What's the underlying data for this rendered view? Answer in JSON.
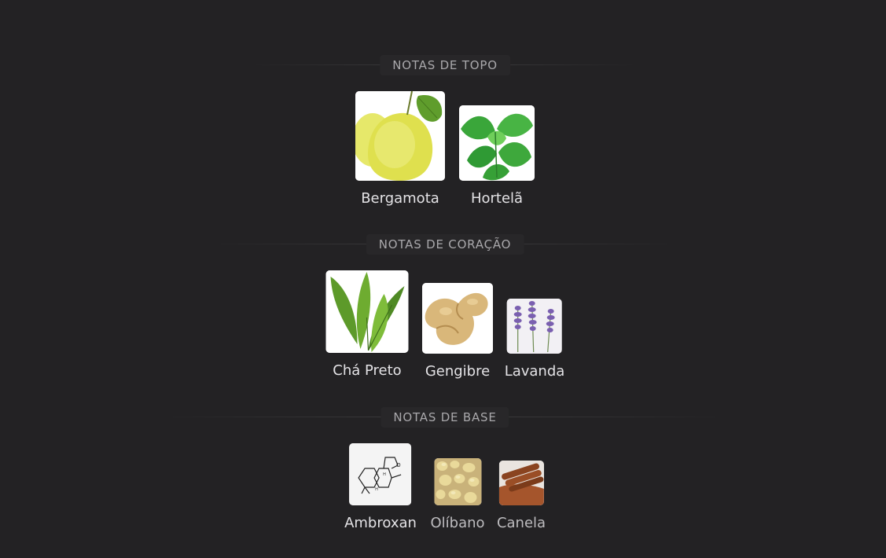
{
  "sections": [
    {
      "title": "NOTAS DE TOPO",
      "notes": [
        {
          "label": "Bergamota",
          "icon": "bergamot-image"
        },
        {
          "label": "Hortelã",
          "icon": "mint-image"
        }
      ]
    },
    {
      "title": "NOTAS DE CORAÇÃO",
      "notes": [
        {
          "label": "Chá Preto",
          "icon": "tea-leaf-image"
        },
        {
          "label": "Gengibre",
          "icon": "ginger-image"
        },
        {
          "label": "Lavanda",
          "icon": "lavender-image"
        }
      ]
    },
    {
      "title": "NOTAS DE BASE",
      "notes": [
        {
          "label": "Ambroxan",
          "icon": "ambroxan-molecule-image"
        },
        {
          "label": "Olíbano",
          "icon": "frankincense-image"
        },
        {
          "label": "Canela",
          "icon": "cinnamon-image"
        }
      ]
    }
  ],
  "colors": {
    "background": "#232224",
    "header_text": "#a9a8ab",
    "label_text": "#e4e3e6"
  }
}
